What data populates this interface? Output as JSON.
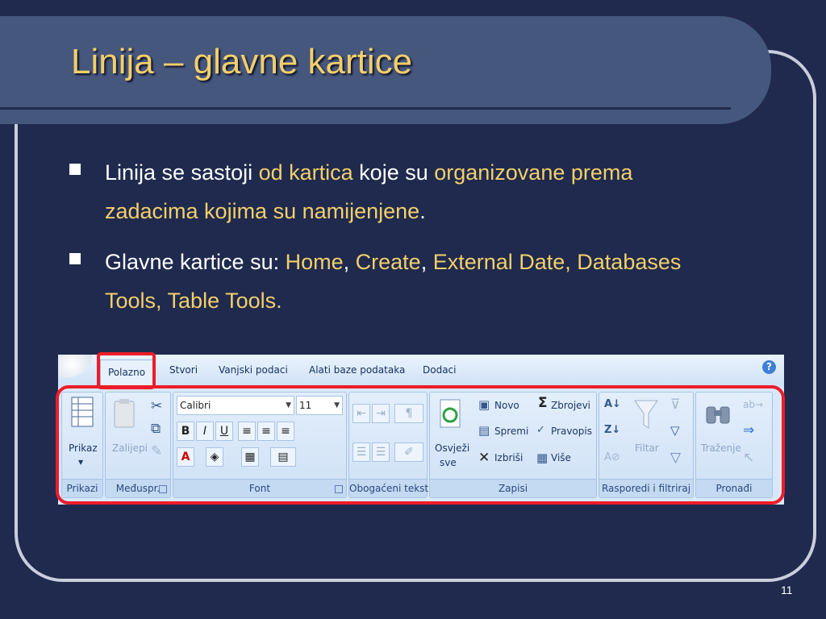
{
  "slide": {
    "title": "Linija – glavne kartice",
    "page_number": "11",
    "bullets": [
      {
        "parts": [
          "Linija se sastoji ",
          "od kartica",
          " koje su ",
          "organizovane prema zadacima kojima su namijenjene",
          "."
        ]
      },
      {
        "parts": [
          "Glavne kartice su: ",
          "Home",
          ", ",
          "Create",
          ", ",
          "External Date, Databases Tools, Table Tools."
        ]
      }
    ]
  },
  "ribbon": {
    "tabs": [
      "Polazno",
      "Stvori",
      "Vanjski podaci",
      "Alati baze podataka",
      "Dodaci"
    ],
    "help": "?",
    "groups": {
      "prikazi": {
        "label": "Prikazi",
        "prikaz": "Prikaz"
      },
      "meduspr": {
        "label": "Međuspr.",
        "zalijepi": "Zalijepi"
      },
      "font": {
        "label": "Font",
        "font_name": "Calibri",
        "font_size": "11",
        "bold": "B",
        "italic": "I",
        "underline": "U"
      },
      "obogaceni": {
        "label": "Obogaćeni tekst"
      },
      "zapisi": {
        "label": "Zapisi",
        "osvjezi_line1": "Osvježi",
        "osvjezi_line2": "sve",
        "novo": "Novo",
        "spremi": "Spremi",
        "izbrisi": "Izbriši",
        "zbrojevi": "Zbrojevi",
        "pravopis": "Pravopis",
        "vise": "Više"
      },
      "rasporedi": {
        "label": "Rasporedi i filtriraj",
        "filtar": "Filtar"
      },
      "pronadi": {
        "label": "Pronađi",
        "trazenje": "Traženje"
      }
    }
  },
  "colors": {
    "background": "#1f2a4e",
    "title_bar": "#46577e",
    "title_text": "#f3cf6a",
    "highlight_text": "#f3cf6a",
    "frame": "#c9cedd",
    "red_outline": "#ee1c2a"
  },
  "icons": [
    "office-button-icon",
    "help-icon",
    "datasheet-view-icon",
    "clipboard-icon",
    "scissors-icon",
    "copy-icon",
    "format-painter-icon",
    "refresh-icon",
    "sigma-icon",
    "spellcheck-icon",
    "delete-x-icon",
    "filter-funnel-icon",
    "binoculars-icon"
  ]
}
